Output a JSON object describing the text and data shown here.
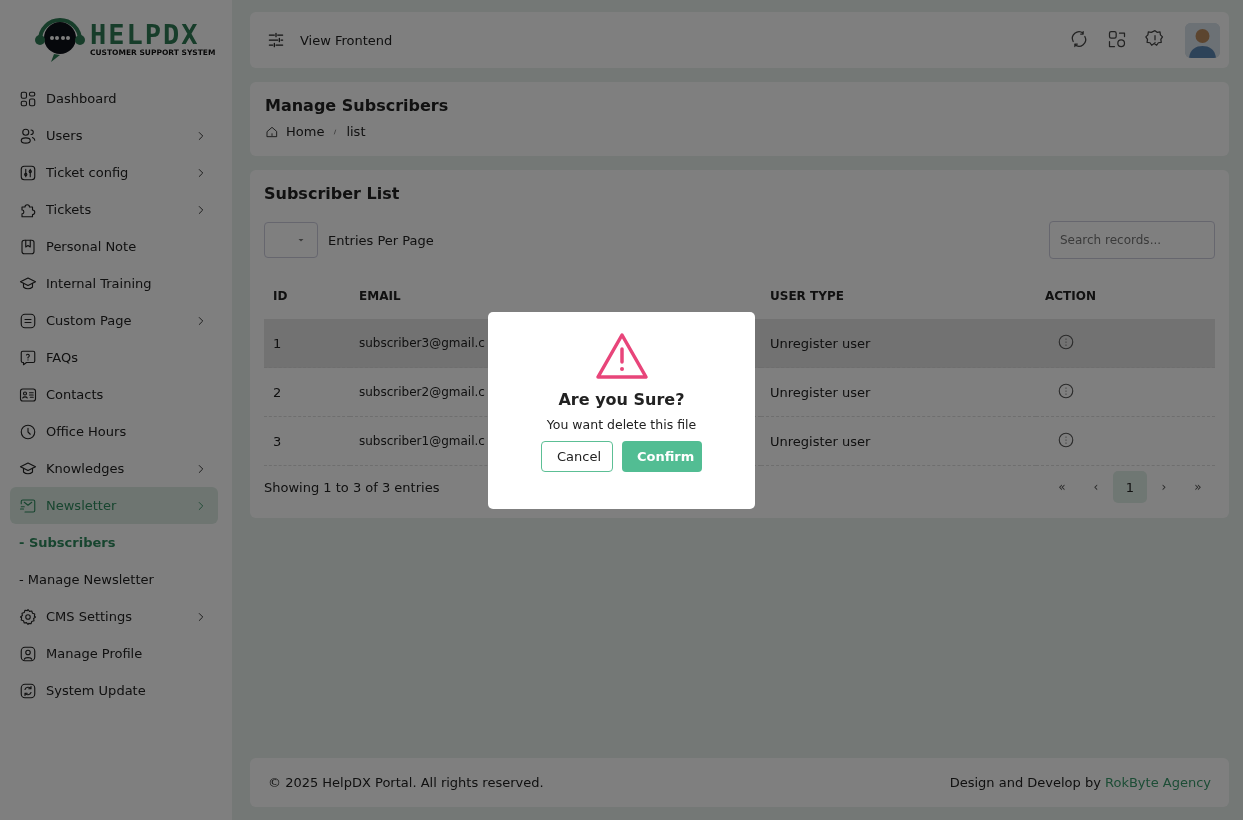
{
  "logo": {
    "name": "HELPDX",
    "tagline": "CUSTOMER SUPPORT SYSTEM"
  },
  "sidebar": {
    "items": [
      {
        "label": "Dashboard",
        "expandable": false,
        "selected": false
      },
      {
        "label": "Users",
        "expandable": true,
        "selected": false
      },
      {
        "label": "Ticket config",
        "expandable": true,
        "selected": false
      },
      {
        "label": "Tickets",
        "expandable": true,
        "selected": false
      },
      {
        "label": "Personal Note",
        "expandable": false,
        "selected": false
      },
      {
        "label": "Internal Training",
        "expandable": false,
        "selected": false
      },
      {
        "label": "Custom Page",
        "expandable": true,
        "selected": false
      },
      {
        "label": "FAQs",
        "expandable": false,
        "selected": false
      },
      {
        "label": "Contacts",
        "expandable": false,
        "selected": false
      },
      {
        "label": "Office Hours",
        "expandable": false,
        "selected": false
      },
      {
        "label": "Knowledges",
        "expandable": true,
        "selected": false
      },
      {
        "label": "Newsletter",
        "expandable": true,
        "selected": true,
        "children": [
          {
            "label": "- Subscribers",
            "selected": true
          },
          {
            "label": "- Manage Newsletter",
            "selected": false
          }
        ]
      },
      {
        "label": "CMS Settings",
        "expandable": true,
        "selected": false
      },
      {
        "label": "Manage Profile",
        "expandable": false,
        "selected": false
      },
      {
        "label": "System Update",
        "expandable": false,
        "selected": false
      }
    ]
  },
  "header": {
    "link": "View Frontend"
  },
  "page_title": {
    "title": "Manage Subscribers",
    "breadcrumbs": [
      "Home",
      "list"
    ]
  },
  "card": {
    "title": "Subscriber List",
    "entries_label": "Entries Per Page",
    "search": {
      "placeholder": "Search records..."
    },
    "table": {
      "columns": [
        "ID",
        "EMAIL",
        "USER TYPE",
        "ACTION"
      ],
      "rows": [
        {
          "id": "1",
          "email": "subscriber3@gmail.c",
          "user_type": "Unregister user",
          "selected": true
        },
        {
          "id": "2",
          "email": "subscriber2@gmail.c",
          "user_type": "Unregister user",
          "selected": false
        },
        {
          "id": "3",
          "email": "subscriber1@gmail.c",
          "user_type": "Unregister user",
          "selected": false
        }
      ]
    },
    "summary": "Showing 1 to 3 of 3 entries",
    "pagination": [
      {
        "label": "«",
        "selected": false
      },
      {
        "label": "‹",
        "selected": false
      },
      {
        "label": "1",
        "selected": true
      },
      {
        "label": "›",
        "selected": false
      },
      {
        "label": "»",
        "selected": false
      }
    ]
  },
  "footer": {
    "copyright": "© 2025 HelpDX Portal. All rights reserved.",
    "credit": "Design and Develop by",
    "credit_link": "RokByte Agency"
  },
  "dialog": {
    "title": "Are you Sure?",
    "message": "You want delete this file",
    "buttons": [
      {
        "label": "Cancel",
        "kind": "secondary"
      },
      {
        "label": "Confirm",
        "kind": "primary"
      }
    ]
  }
}
